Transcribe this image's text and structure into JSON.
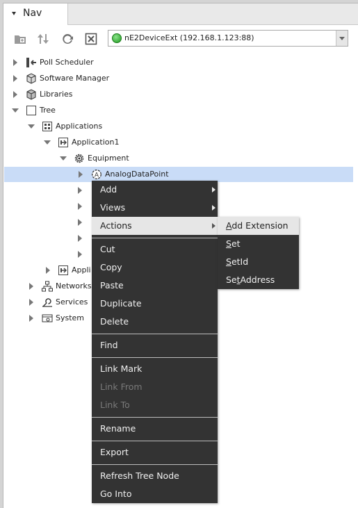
{
  "nav": {
    "tab_label": "Nav",
    "station_label": "nE2DeviceExt (192.168.1.123:88)"
  },
  "tree": {
    "items": [
      {
        "label": "Poll Scheduler"
      },
      {
        "label": "Software Manager"
      },
      {
        "label": "Libraries"
      },
      {
        "label": "Tree"
      },
      {
        "label": "Applications"
      },
      {
        "label": "Application1"
      },
      {
        "label": "Equipment"
      },
      {
        "label": "AnalogDataPoint"
      },
      {
        "label": "Appli"
      },
      {
        "label": "Networks"
      },
      {
        "label": "Services"
      },
      {
        "label": "System"
      }
    ]
  },
  "context_menu": {
    "items": [
      {
        "label": "Add"
      },
      {
        "label": "Views"
      },
      {
        "label": "Actions"
      },
      {
        "label": "Cut"
      },
      {
        "label": "Copy"
      },
      {
        "label": "Paste"
      },
      {
        "label": "Duplicate"
      },
      {
        "label": "Delete"
      },
      {
        "label": "Find"
      },
      {
        "label": "Link Mark"
      },
      {
        "label": "Link From"
      },
      {
        "label": "Link To"
      },
      {
        "label": "Rename"
      },
      {
        "label": "Export"
      },
      {
        "label": "Refresh Tree Node"
      },
      {
        "label": "Go Into"
      }
    ]
  },
  "submenu": {
    "items": [
      {
        "pre": "",
        "key": "A",
        "post": "dd Extension"
      },
      {
        "pre": "",
        "key": "S",
        "post": "et"
      },
      {
        "pre": "",
        "key": "S",
        "post": "etId"
      },
      {
        "pre": "Se",
        "key": "t",
        "post": "Address"
      }
    ]
  }
}
